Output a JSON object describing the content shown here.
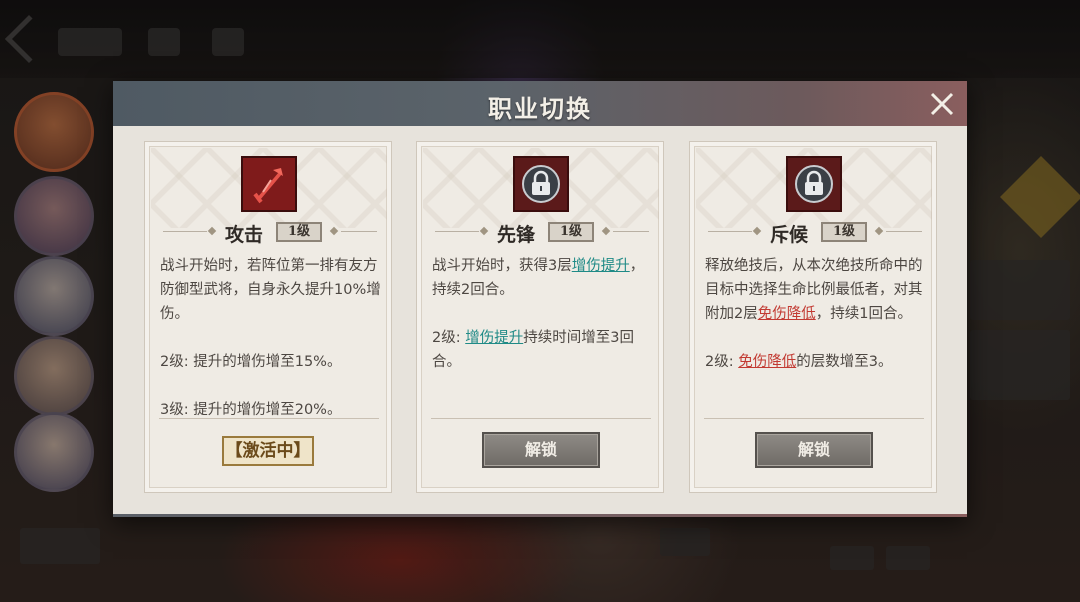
{
  "modal": {
    "title": "职业切换"
  },
  "cards": [
    {
      "name": "攻击",
      "level": "1级",
      "icon": "sword-slash-icon",
      "desc": [
        [
          "战斗开始时，若阵位第一排有友方防御型武将，自身永久提升10%增伤。"
        ],
        [
          "2级: 提升的增伤增至15%。"
        ],
        [
          "3级: 提升的增伤增至20%。"
        ]
      ],
      "status": "【激活中】"
    },
    {
      "name": "先锋",
      "level": "1级",
      "icon": "lock-icon",
      "desc_p1_a": "战斗开始时，获得3层",
      "desc_p1_link": "增伤提升",
      "desc_p1_b": "，持续2回合。",
      "desc_p2_a": "2级: ",
      "desc_p2_link": "增伤提升",
      "desc_p2_b": "持续时间增至3回合。",
      "button": "解锁"
    },
    {
      "name": "斥候",
      "level": "1级",
      "icon": "lock-icon",
      "desc_p1_a": "释放绝技后，从本次绝技所命中的目标中选择生命比例最低者，对其附加2层",
      "desc_p1_link": "免伤降低",
      "desc_p1_b": "，持续1回合。",
      "desc_p2_a": "2级: ",
      "desc_p2_link": "免伤降低",
      "desc_p2_b": "的层数增至3。",
      "button": "解锁"
    }
  ],
  "colors": {
    "accent_teal": "#1f8a86",
    "accent_red": "#c23a32",
    "icon_bg": "#7f1b1b"
  }
}
